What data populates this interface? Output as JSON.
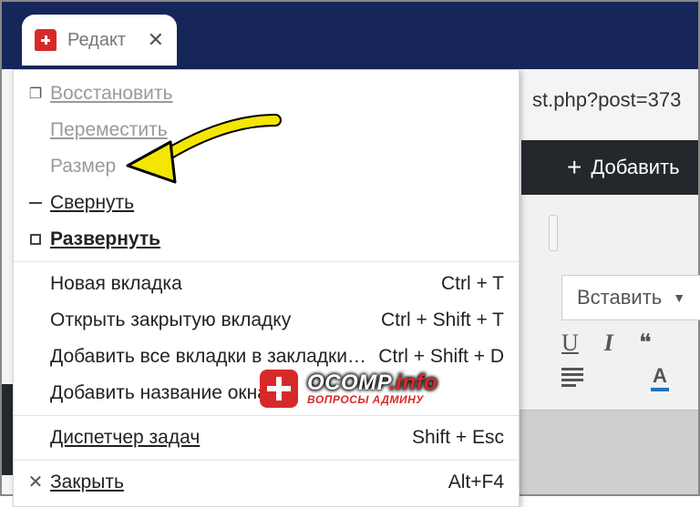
{
  "tab": {
    "title": "Редакт",
    "close": "✕"
  },
  "url_fragment": "st.php?post=373",
  "toolbar_add": "Добавить",
  "insert_button": "Вставить",
  "menu": {
    "restore": "Восстановить",
    "move": "Переместить",
    "size": "Размер",
    "minimize": "Свернуть",
    "maximize": "Развернуть",
    "new_tab": {
      "label": "Новая вкладка",
      "shortcut": "Ctrl + T"
    },
    "reopen_tab": {
      "label": "Открыть закрытую вкладку",
      "shortcut": "Ctrl + Shift + T"
    },
    "bookmark_all": {
      "label": "Добавить все вкладки в закладки…",
      "shortcut": "Ctrl + Shift + D"
    },
    "name_window": "Добавить название окна",
    "task_manager": {
      "label": "Диспетчер задач",
      "shortcut": "Shift + Esc"
    },
    "close": {
      "label": "Закрыть",
      "shortcut": "Alt+F4"
    }
  },
  "watermark": {
    "brand": "OCOMP",
    "suffix": ".info",
    "tagline": "ВОПРОСЫ АДМИНУ"
  },
  "editor_icons": {
    "underline": "U",
    "italic": "I",
    "quote": "❝",
    "color": "A"
  }
}
